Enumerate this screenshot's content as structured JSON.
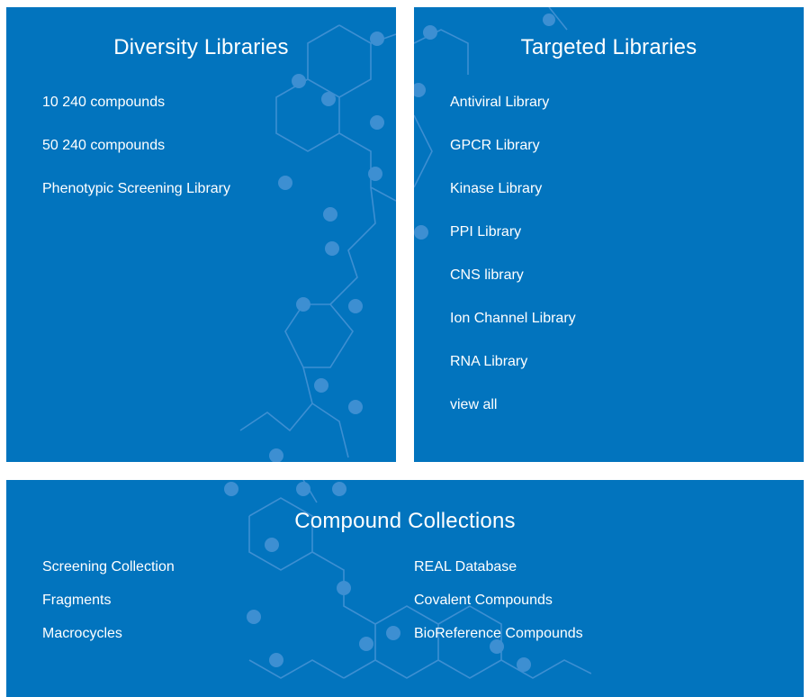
{
  "diversity": {
    "title": "Diversity Libraries",
    "links": [
      "10 240 compounds",
      "50 240 compounds",
      "Phenotypic Screening Library"
    ]
  },
  "targeted": {
    "title": "Targeted Libraries",
    "links": [
      "Antiviral Library",
      "GPCR Library",
      "Kinase Library",
      "PPI Library",
      "CNS library",
      "Ion Channel Library",
      "RNA Library",
      "view all"
    ]
  },
  "compound": {
    "title": "Compound Collections",
    "left_links": [
      "Screening Collection",
      "Fragments",
      "Macrocycles"
    ],
    "right_links": [
      "REAL Database",
      "Covalent Compounds",
      "BioReference Compounds"
    ]
  },
  "colors": {
    "panel_background": "#0274be",
    "decor_molecule": "#3d8fd2",
    "text": "#ffffff"
  }
}
